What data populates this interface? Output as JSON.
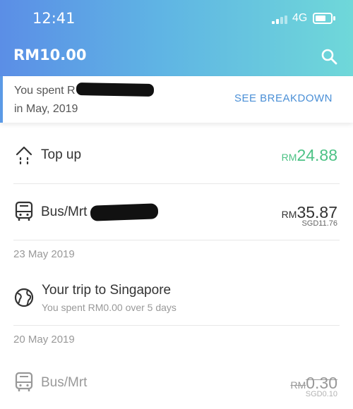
{
  "status_bar": {
    "time": "12:41",
    "network": "4G"
  },
  "header": {
    "balance": "RM10.00"
  },
  "summary": {
    "line1": "You spent R",
    "line2": "in May, 2019",
    "action": "SEE BREAKDOWN"
  },
  "transactions": [
    {
      "title": "Top up",
      "currency": "RM",
      "amount": "24.88",
      "icon": "top-up-arrow-icon"
    },
    {
      "title": "Bus/Mrt",
      "currency": "RM",
      "amount": "35.87",
      "sub_amount": "SGD11.76",
      "icon": "bus-icon"
    }
  ],
  "date1": "23 May 2019",
  "trip": {
    "title": "Your trip to Singapore",
    "subtitle": "You spent RM0.00 over 5 days",
    "icon": "globe-icon"
  },
  "date2": "20 May 2019",
  "last_txn": {
    "title": "Bus/Mrt",
    "currency": "RM",
    "amount": "0.30",
    "sub_amount": "SGD0.10",
    "icon": "bus-icon"
  },
  "colors": {
    "accent_blue": "#4a8fd6",
    "positive_green": "#4cc285"
  }
}
